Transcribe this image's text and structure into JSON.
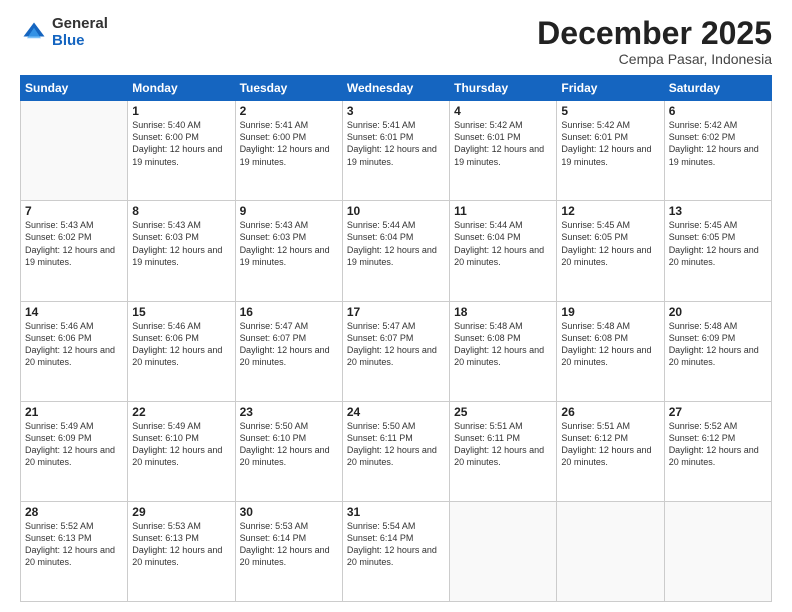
{
  "logo": {
    "general": "General",
    "blue": "Blue"
  },
  "header": {
    "month": "December 2025",
    "location": "Cempa Pasar, Indonesia"
  },
  "weekdays": [
    "Sunday",
    "Monday",
    "Tuesday",
    "Wednesday",
    "Thursday",
    "Friday",
    "Saturday"
  ],
  "weeks": [
    [
      {
        "day": "",
        "sunrise": "",
        "sunset": "",
        "daylight": "",
        "empty": true
      },
      {
        "day": "1",
        "sunrise": "Sunrise: 5:40 AM",
        "sunset": "Sunset: 6:00 PM",
        "daylight": "Daylight: 12 hours and 19 minutes."
      },
      {
        "day": "2",
        "sunrise": "Sunrise: 5:41 AM",
        "sunset": "Sunset: 6:00 PM",
        "daylight": "Daylight: 12 hours and 19 minutes."
      },
      {
        "day": "3",
        "sunrise": "Sunrise: 5:41 AM",
        "sunset": "Sunset: 6:01 PM",
        "daylight": "Daylight: 12 hours and 19 minutes."
      },
      {
        "day": "4",
        "sunrise": "Sunrise: 5:42 AM",
        "sunset": "Sunset: 6:01 PM",
        "daylight": "Daylight: 12 hours and 19 minutes."
      },
      {
        "day": "5",
        "sunrise": "Sunrise: 5:42 AM",
        "sunset": "Sunset: 6:01 PM",
        "daylight": "Daylight: 12 hours and 19 minutes."
      },
      {
        "day": "6",
        "sunrise": "Sunrise: 5:42 AM",
        "sunset": "Sunset: 6:02 PM",
        "daylight": "Daylight: 12 hours and 19 minutes."
      }
    ],
    [
      {
        "day": "7",
        "sunrise": "Sunrise: 5:43 AM",
        "sunset": "Sunset: 6:02 PM",
        "daylight": "Daylight: 12 hours and 19 minutes."
      },
      {
        "day": "8",
        "sunrise": "Sunrise: 5:43 AM",
        "sunset": "Sunset: 6:03 PM",
        "daylight": "Daylight: 12 hours and 19 minutes."
      },
      {
        "day": "9",
        "sunrise": "Sunrise: 5:43 AM",
        "sunset": "Sunset: 6:03 PM",
        "daylight": "Daylight: 12 hours and 19 minutes."
      },
      {
        "day": "10",
        "sunrise": "Sunrise: 5:44 AM",
        "sunset": "Sunset: 6:04 PM",
        "daylight": "Daylight: 12 hours and 19 minutes."
      },
      {
        "day": "11",
        "sunrise": "Sunrise: 5:44 AM",
        "sunset": "Sunset: 6:04 PM",
        "daylight": "Daylight: 12 hours and 20 minutes."
      },
      {
        "day": "12",
        "sunrise": "Sunrise: 5:45 AM",
        "sunset": "Sunset: 6:05 PM",
        "daylight": "Daylight: 12 hours and 20 minutes."
      },
      {
        "day": "13",
        "sunrise": "Sunrise: 5:45 AM",
        "sunset": "Sunset: 6:05 PM",
        "daylight": "Daylight: 12 hours and 20 minutes."
      }
    ],
    [
      {
        "day": "14",
        "sunrise": "Sunrise: 5:46 AM",
        "sunset": "Sunset: 6:06 PM",
        "daylight": "Daylight: 12 hours and 20 minutes."
      },
      {
        "day": "15",
        "sunrise": "Sunrise: 5:46 AM",
        "sunset": "Sunset: 6:06 PM",
        "daylight": "Daylight: 12 hours and 20 minutes."
      },
      {
        "day": "16",
        "sunrise": "Sunrise: 5:47 AM",
        "sunset": "Sunset: 6:07 PM",
        "daylight": "Daylight: 12 hours and 20 minutes."
      },
      {
        "day": "17",
        "sunrise": "Sunrise: 5:47 AM",
        "sunset": "Sunset: 6:07 PM",
        "daylight": "Daylight: 12 hours and 20 minutes."
      },
      {
        "day": "18",
        "sunrise": "Sunrise: 5:48 AM",
        "sunset": "Sunset: 6:08 PM",
        "daylight": "Daylight: 12 hours and 20 minutes."
      },
      {
        "day": "19",
        "sunrise": "Sunrise: 5:48 AM",
        "sunset": "Sunset: 6:08 PM",
        "daylight": "Daylight: 12 hours and 20 minutes."
      },
      {
        "day": "20",
        "sunrise": "Sunrise: 5:48 AM",
        "sunset": "Sunset: 6:09 PM",
        "daylight": "Daylight: 12 hours and 20 minutes."
      }
    ],
    [
      {
        "day": "21",
        "sunrise": "Sunrise: 5:49 AM",
        "sunset": "Sunset: 6:09 PM",
        "daylight": "Daylight: 12 hours and 20 minutes."
      },
      {
        "day": "22",
        "sunrise": "Sunrise: 5:49 AM",
        "sunset": "Sunset: 6:10 PM",
        "daylight": "Daylight: 12 hours and 20 minutes."
      },
      {
        "day": "23",
        "sunrise": "Sunrise: 5:50 AM",
        "sunset": "Sunset: 6:10 PM",
        "daylight": "Daylight: 12 hours and 20 minutes."
      },
      {
        "day": "24",
        "sunrise": "Sunrise: 5:50 AM",
        "sunset": "Sunset: 6:11 PM",
        "daylight": "Daylight: 12 hours and 20 minutes."
      },
      {
        "day": "25",
        "sunrise": "Sunrise: 5:51 AM",
        "sunset": "Sunset: 6:11 PM",
        "daylight": "Daylight: 12 hours and 20 minutes."
      },
      {
        "day": "26",
        "sunrise": "Sunrise: 5:51 AM",
        "sunset": "Sunset: 6:12 PM",
        "daylight": "Daylight: 12 hours and 20 minutes."
      },
      {
        "day": "27",
        "sunrise": "Sunrise: 5:52 AM",
        "sunset": "Sunset: 6:12 PM",
        "daylight": "Daylight: 12 hours and 20 minutes."
      }
    ],
    [
      {
        "day": "28",
        "sunrise": "Sunrise: 5:52 AM",
        "sunset": "Sunset: 6:13 PM",
        "daylight": "Daylight: 12 hours and 20 minutes."
      },
      {
        "day": "29",
        "sunrise": "Sunrise: 5:53 AM",
        "sunset": "Sunset: 6:13 PM",
        "daylight": "Daylight: 12 hours and 20 minutes."
      },
      {
        "day": "30",
        "sunrise": "Sunrise: 5:53 AM",
        "sunset": "Sunset: 6:14 PM",
        "daylight": "Daylight: 12 hours and 20 minutes."
      },
      {
        "day": "31",
        "sunrise": "Sunrise: 5:54 AM",
        "sunset": "Sunset: 6:14 PM",
        "daylight": "Daylight: 12 hours and 20 minutes."
      },
      {
        "day": "",
        "sunrise": "",
        "sunset": "",
        "daylight": "",
        "empty": true
      },
      {
        "day": "",
        "sunrise": "",
        "sunset": "",
        "daylight": "",
        "empty": true
      },
      {
        "day": "",
        "sunrise": "",
        "sunset": "",
        "daylight": "",
        "empty": true
      }
    ]
  ]
}
